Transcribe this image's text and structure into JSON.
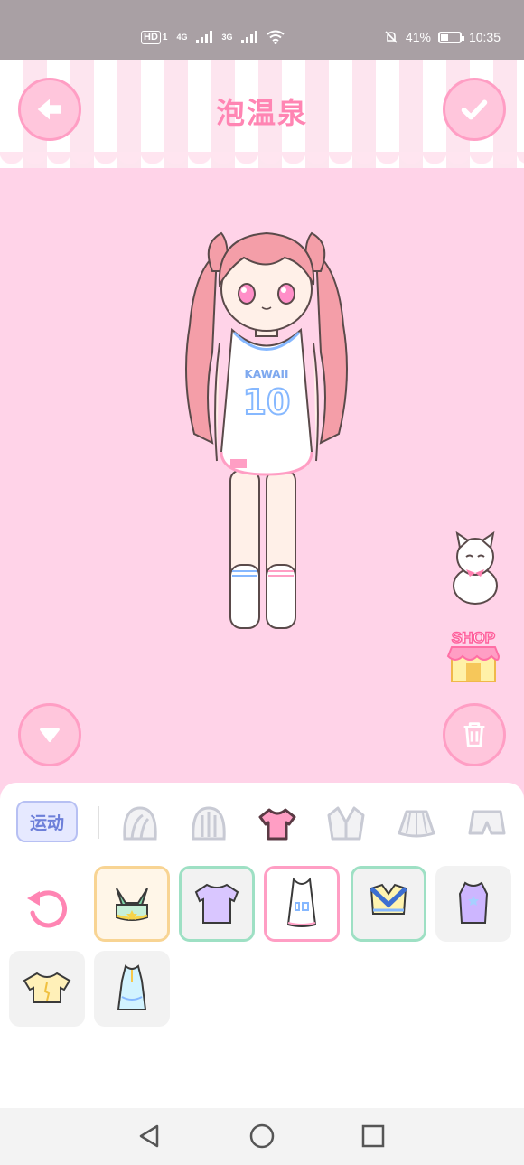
{
  "status_bar": {
    "network_hd": "HD",
    "sim1": "1",
    "net1": "4G",
    "net2": "3G",
    "battery_percent": "41%",
    "battery_level": 0.41,
    "time": "10:35"
  },
  "header": {
    "title": "泡温泉",
    "back_icon": "arrow-left-icon",
    "confirm_icon": "check-icon"
  },
  "character": {
    "shirt_text": "KAWAII",
    "shirt_number": "10"
  },
  "side": {
    "shop_label": "SHOP"
  },
  "categories": {
    "active_tab": "运动",
    "icons": [
      "hair-icon",
      "hat-icon",
      "shirt-icon",
      "jacket-icon",
      "skirt-icon",
      "shorts-icon"
    ]
  },
  "colors": {
    "accent_pink": "#ff85b3",
    "background_pink": "#ffd3e8",
    "tab_blue": "#6d7fd9"
  }
}
